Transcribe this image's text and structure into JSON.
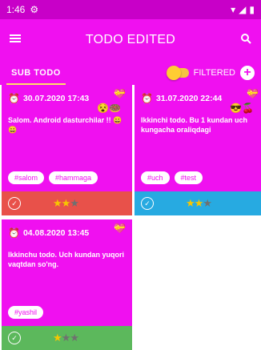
{
  "status": {
    "time": "1:46",
    "settings_icon": "⚙"
  },
  "appbar": {
    "title": "TODO EDITED"
  },
  "subbar": {
    "tab": "SUB TODO",
    "filter_label": "FILTERED",
    "add": "+"
  },
  "cards": [
    {
      "date": "30.07.2020 17:43",
      "text": "Salom. Android dasturchilar !! 😀😀",
      "tags": [
        "#salom",
        "#hammaga"
      ],
      "footer_color": "#e8514a",
      "rating": 2,
      "emoji_top": "💝",
      "emoji_mid": "😵🍩"
    },
    {
      "date": "31.07.2020 22:44",
      "text": "Ikkinchi todo. Bu 1 kundan uch kungacha oraliqdagi",
      "tags": [
        "#uch",
        "#test"
      ],
      "footer_color": "#27aae1",
      "rating": 2,
      "emoji_top": "💝",
      "emoji_mid": "😎🍒"
    },
    {
      "date": "04.08.2020 13:45",
      "text": "Ikkinchu todo. Uch kundan yuqori vaqtdan so'ng.",
      "tags": [
        "#yashil"
      ],
      "footer_color": "#5cb85c",
      "rating": 1,
      "emoji_top": "💝",
      "emoji_mid": ""
    }
  ]
}
